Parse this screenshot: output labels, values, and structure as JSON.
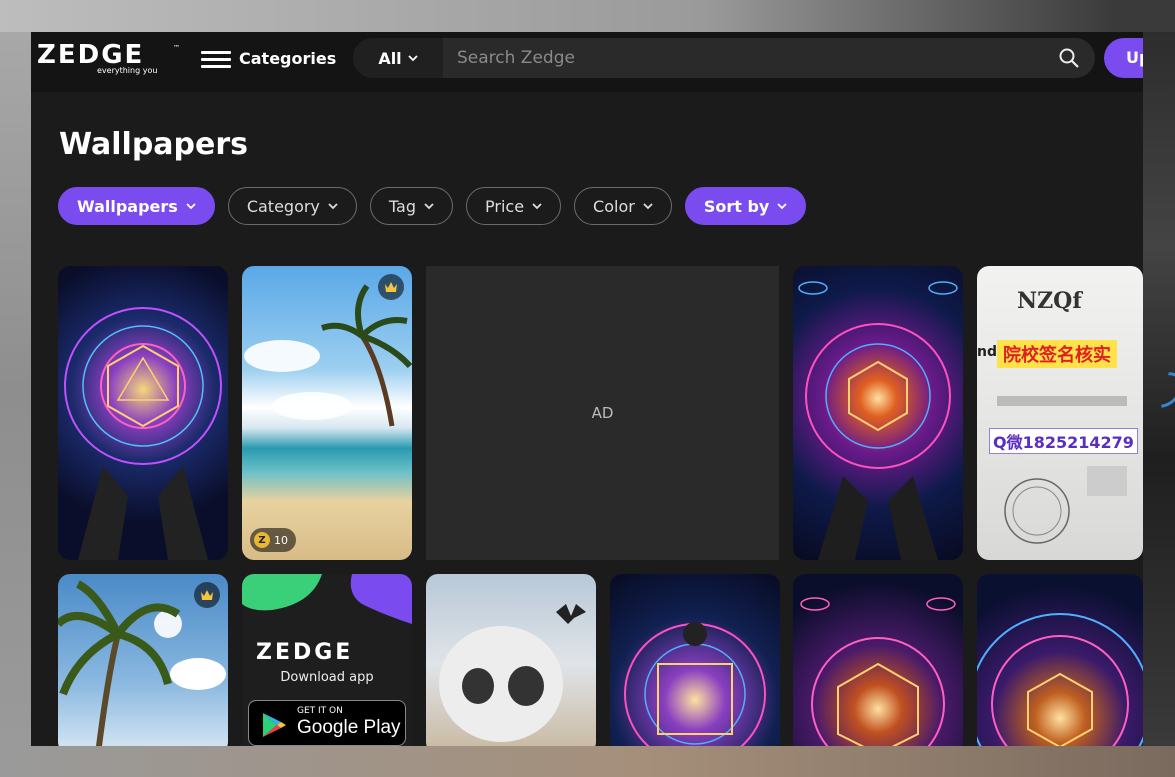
{
  "header": {
    "logo_text": "ZEDGE",
    "logo_tagline": "everything you",
    "categories_label": "Categories",
    "search_scope": "All",
    "search_placeholder": "Search Zedge",
    "upgrade_label": "Up"
  },
  "page": {
    "title": "Wallpapers"
  },
  "filters": [
    {
      "label": "Wallpapers",
      "active": true
    },
    {
      "label": "Category",
      "active": false
    },
    {
      "label": "Tag",
      "active": false
    },
    {
      "label": "Price",
      "active": false
    },
    {
      "label": "Color",
      "active": false
    },
    {
      "label": "Sort by",
      "active": true
    }
  ],
  "tiles": {
    "ad_label": "AD",
    "beach_price": "10",
    "app_promo": {
      "logo_text": "ZEDGE",
      "download_label": "Download app",
      "store_small": "GET IT ON",
      "store_big": "Google Play"
    },
    "diploma": {
      "brand": "NZQf",
      "prefix": "nd",
      "banner": "院校签名核实",
      "contact": "Q微1825214279"
    }
  },
  "colors": {
    "accent": "#7a4cf0",
    "background": "#1b1b1b",
    "header": "#141414",
    "chip_border": "#6b6b6b"
  }
}
